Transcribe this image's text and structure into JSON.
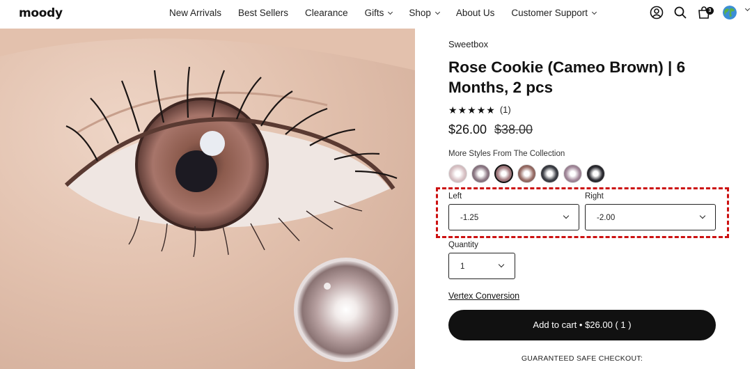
{
  "header": {
    "logo": "moody",
    "nav": [
      {
        "label": "New Arrivals",
        "has_dropdown": false
      },
      {
        "label": "Best Sellers",
        "has_dropdown": false
      },
      {
        "label": "Clearance",
        "has_dropdown": false
      },
      {
        "label": "Gifts",
        "has_dropdown": true
      },
      {
        "label": "Shop",
        "has_dropdown": true
      },
      {
        "label": "About Us",
        "has_dropdown": false
      },
      {
        "label": "Customer Support",
        "has_dropdown": true
      }
    ],
    "icons": [
      "account-icon",
      "search-icon",
      "cart-icon",
      "globe-icon"
    ],
    "cart_count": "3"
  },
  "product": {
    "brand": "Sweetbox",
    "title": "Rose Cookie (Cameo Brown) | 6 Months, 2 pcs",
    "rating_stars": 5,
    "review_count": "(1)",
    "price": "$26.00",
    "compare_price": "$38.00",
    "more_styles_label": "More Styles From The Collection",
    "swatches": [
      {
        "color": "#d9c3c6",
        "selected": false
      },
      {
        "color": "#8e7a86",
        "selected": false
      },
      {
        "color": "#a57e82",
        "selected": true
      },
      {
        "color": "#9a6f68",
        "selected": false
      },
      {
        "color": "#3e4047",
        "selected": false
      },
      {
        "color": "#a48a9c",
        "selected": false
      },
      {
        "color": "#2d2d33",
        "selected": false
      }
    ],
    "left_label": "Left",
    "left_value": "-1.25",
    "right_label": "Right",
    "right_value": "-2.00",
    "quantity_label": "Quantity",
    "quantity_value": "1",
    "vertex_link": "Vertex Conversion",
    "add_to_cart": "Add to cart • $26.00 ( 1 )",
    "guarantee": "GUARANTEED SAFE CHECKOUT:"
  },
  "colors": {
    "highlight": "#cc1111",
    "primary": "#111111"
  }
}
